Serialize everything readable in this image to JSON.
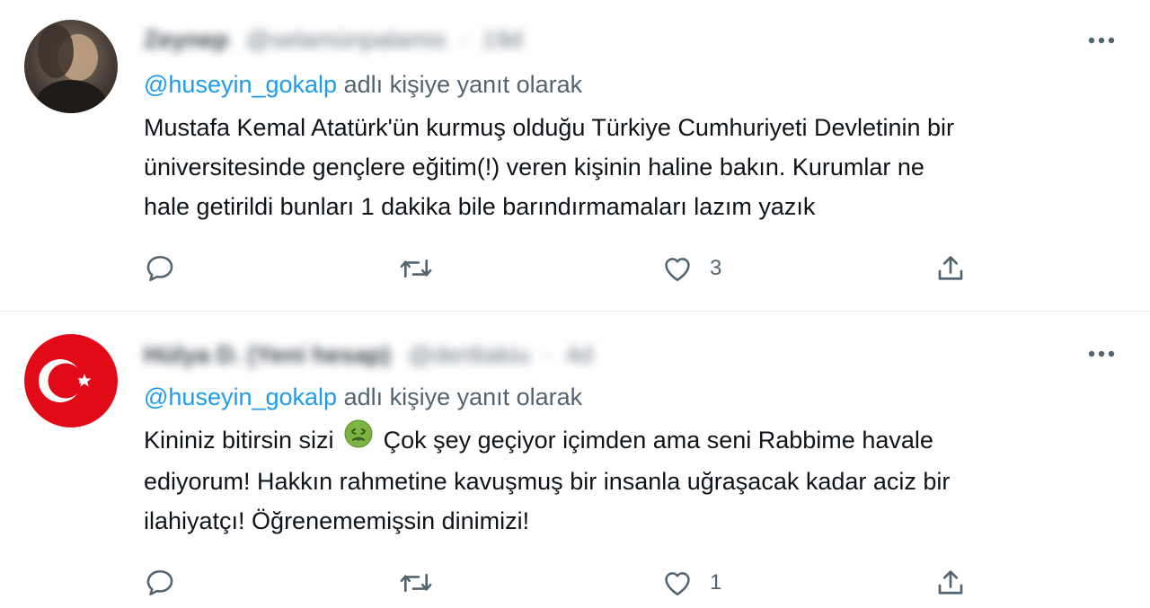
{
  "tweets": [
    {
      "author_name": "Zeynep",
      "author_handle": "@selamünpalamis",
      "time": "19d",
      "reply_prefix": "@huseyin_gokalp",
      "reply_suffix": " adlı kişiye yanıt olarak",
      "text_lines": [
        "Mustafa Kemal Atatürk'ün kurmuş olduğu Türkiye Cumhuriyeti Devletinin bir",
        "üniversitesinde gençlere eğitim(!) veren kişinin haline bakın. Kurumlar ne",
        "hale getirildi bunları 1 dakika bile barındırmamaları lazım yazık"
      ],
      "reply_count": "",
      "retweet_count": "",
      "like_count": "3"
    },
    {
      "author_name": "Hülya D. (Yeni hesap)",
      "author_handle": "@dertliakiu",
      "time": "4d",
      "reply_prefix": "@huseyin_gokalp",
      "reply_suffix": " adlı kişiye yanıt olarak",
      "text_line1_before_emoji": "Kininiz bitirsin sizi",
      "text_line1_after_emoji": "Çok şey geçiyor içimden ama seni Rabbime havale",
      "text_line2": "ediyorum! Hakkın rahmetine kavuşmuş bir insanla uğraşacak kadar aciz bir",
      "text_line3": "ilahiyatçı! Öğrenememişsin dinimizi!",
      "emoji_icon": "nauseated-face-icon",
      "reply_count": "",
      "retweet_count": "",
      "like_count": "1"
    }
  ],
  "colors": {
    "mention": "#1d9bf0",
    "secondary_text": "#536471",
    "primary_text": "#0f1419",
    "divider": "#e6ecf0",
    "flag_red": "#e30a17"
  },
  "icons": [
    "more-icon",
    "reply-icon",
    "retweet-icon",
    "like-icon",
    "share-icon"
  ]
}
